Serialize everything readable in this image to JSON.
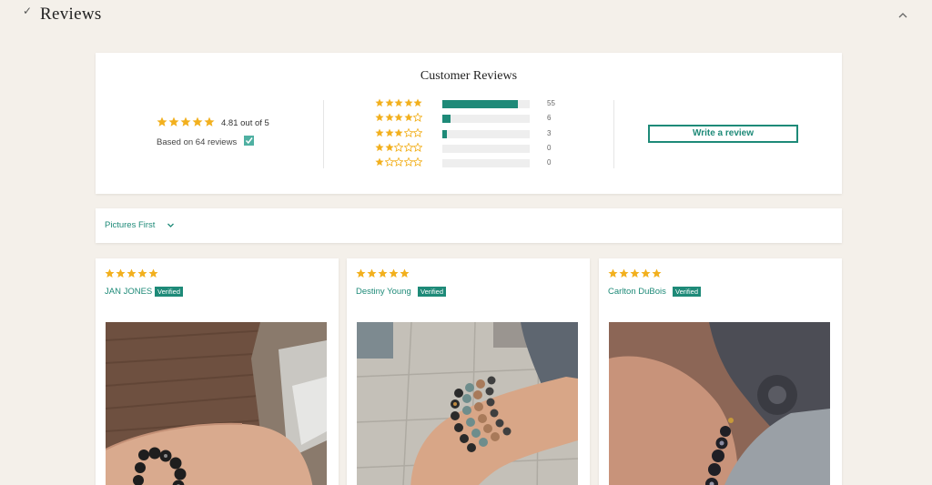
{
  "section": {
    "title": "Reviews",
    "check_icon": "checkmark-icon",
    "collapse_icon": "chevron-up-icon"
  },
  "summary": {
    "title": "Customer Reviews",
    "average_stars": 5,
    "average_text": "4.81 out of 5",
    "based_on_text": "Based on 64 reviews",
    "verified_icon": "verified-badge-icon",
    "distribution": [
      {
        "stars": 5,
        "count": "55",
        "fraction": 0.86
      },
      {
        "stars": 4,
        "count": "6",
        "fraction": 0.09
      },
      {
        "stars": 3,
        "count": "3",
        "fraction": 0.05
      },
      {
        "stars": 2,
        "count": "0",
        "fraction": 0
      },
      {
        "stars": 1,
        "count": "0",
        "fraction": 0
      }
    ],
    "write_button_label": "Write a review"
  },
  "sort": {
    "label": "Pictures First",
    "icon": "chevron-down-icon"
  },
  "reviews": [
    {
      "stars": 5,
      "author": "JAN JONES",
      "badge": "Verified",
      "photo": "review-photo-bracelet-wrist"
    },
    {
      "stars": 5,
      "author": "Destiny Young",
      "badge": "Verified",
      "photo": "review-photo-stacked-bracelets"
    },
    {
      "stars": 5,
      "author": "Carlton DuBois",
      "badge": "Verified",
      "photo": "review-photo-bracelet-closeup"
    }
  ],
  "colors": {
    "accent": "#1e8a78",
    "star": "#f2b01e",
    "background": "#f4f0ea"
  }
}
